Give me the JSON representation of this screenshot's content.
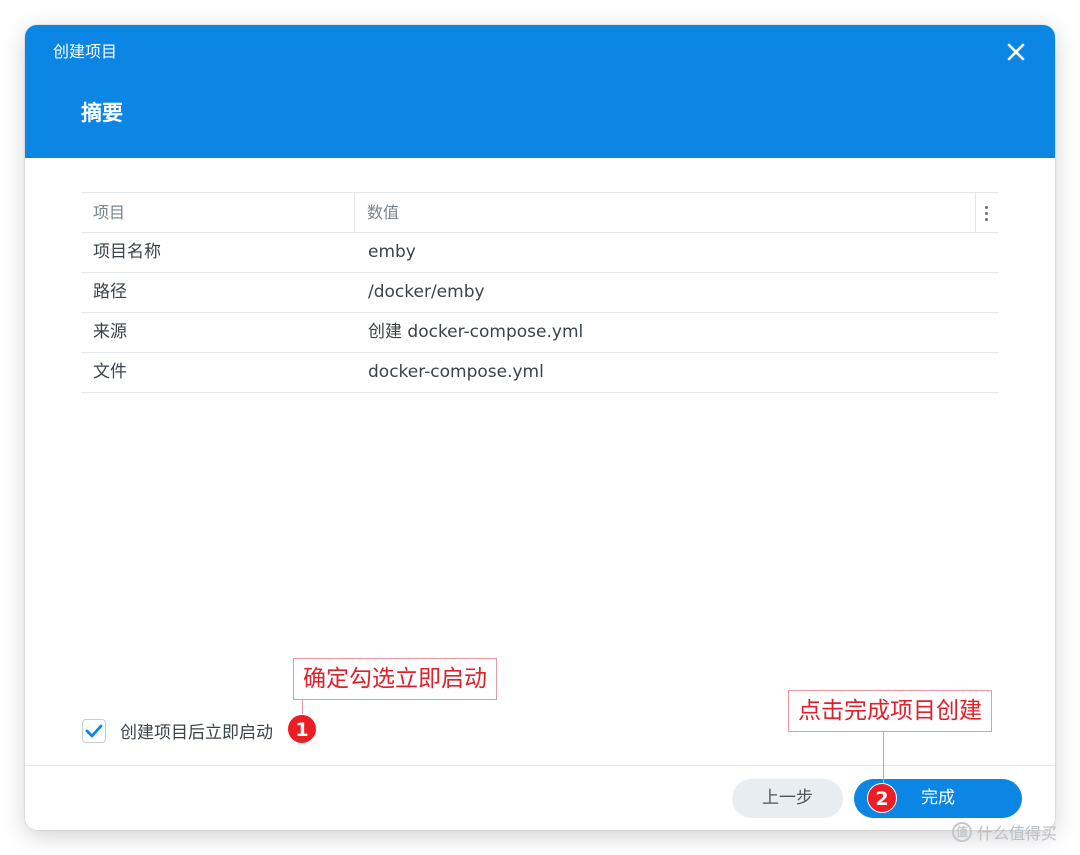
{
  "window": {
    "title": "创建项目",
    "close_icon": "close-icon"
  },
  "section_title": "摘要",
  "grid": {
    "headers": [
      "项目",
      "数值"
    ],
    "rows": [
      {
        "key": "项目名称",
        "value": "emby"
      },
      {
        "key": "路径",
        "value": "/docker/emby"
      },
      {
        "key": "来源",
        "value": "创建 docker-compose.yml"
      },
      {
        "key": "文件",
        "value": "docker-compose.yml"
      }
    ]
  },
  "start_checkbox": {
    "label": "创建项目后立即启动",
    "checked": true
  },
  "buttons": {
    "prev": "上一步",
    "finish": "完成"
  },
  "annotations": [
    {
      "number": "1",
      "text": "确定勾选立即启动"
    },
    {
      "number": "2",
      "text": "点击完成项目创建"
    }
  ],
  "watermark": "什么值得买",
  "colors": {
    "accent": "#0b86e4",
    "annotation": "#e0202a",
    "badge": "#ee1c25"
  }
}
